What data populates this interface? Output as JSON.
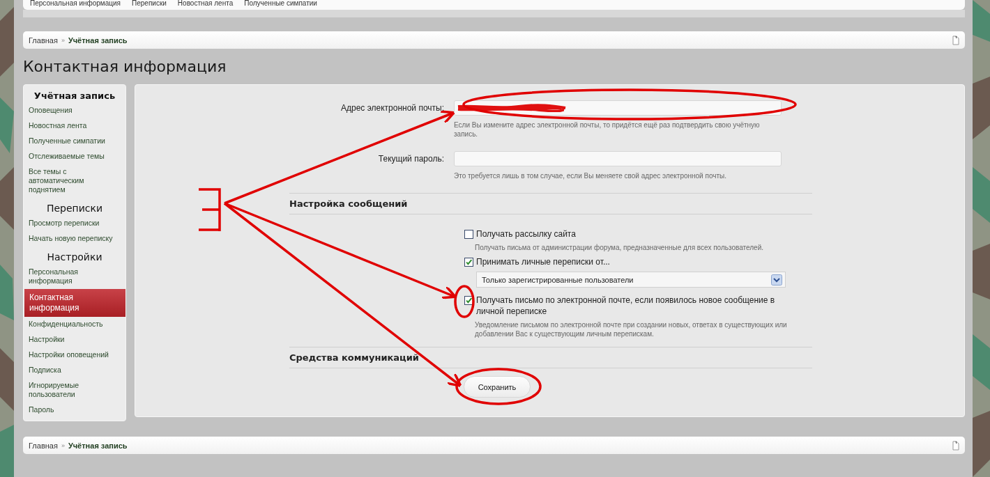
{
  "top_nav": {
    "items": [
      {
        "label": "Персональная информация"
      },
      {
        "label": "Переписки"
      },
      {
        "label": "Новостная лента"
      },
      {
        "label": "Полученные симпатии"
      }
    ]
  },
  "breadcrumb_top": [
    {
      "label": "Главная",
      "current": false
    },
    {
      "separator": "»",
      "label": "Учётная запись",
      "current": true
    }
  ],
  "page_title": "Контактная информация",
  "sidebar": {
    "sections": [
      {
        "heading": "Учётная запись",
        "items": [
          {
            "label": "Оповещения",
            "selected": false
          },
          {
            "label": "Новостная лента",
            "selected": false
          },
          {
            "label": "Полученные симпатии",
            "selected": false
          },
          {
            "label": "Отслеживаемые темы",
            "selected": false
          },
          {
            "label": "Все темы с автоматическим поднятием",
            "selected": false
          }
        ]
      },
      {
        "heading": "Переписки",
        "items": [
          {
            "label": "Просмотр переписки",
            "selected": false
          },
          {
            "label": "Начать новую переписку",
            "selected": false
          }
        ]
      },
      {
        "heading": "Настройки",
        "items": [
          {
            "label": "Персональная информация",
            "selected": false
          },
          {
            "label": "Контактная информация",
            "selected": true
          },
          {
            "label": "Конфиденциальность",
            "selected": false
          },
          {
            "label": "Настройки",
            "selected": false
          },
          {
            "label": "Настройки оповещений",
            "selected": false
          },
          {
            "label": "Подписка",
            "selected": false
          },
          {
            "label": "Игнорируемые пользователи",
            "selected": false
          },
          {
            "label": "Пароль",
            "selected": false
          }
        ]
      }
    ]
  },
  "form": {
    "fields": [
      {
        "label": "Адрес электронной почты:",
        "kind": "email",
        "hint": "Если Вы измените адрес электронной почты, то придётся ещё раз подтвердить свою учётную запись."
      },
      {
        "label": "Текущий пароль:",
        "kind": "password",
        "hint": "Это требуется лишь в том случае, если Вы меняете свой адрес электронной почты."
      }
    ],
    "sections": [
      {
        "heading": "Настройка сообщений",
        "options": [
          {
            "kind": "checkbox",
            "label": "Получать рассылку сайта",
            "checked": false,
            "hint": "Получать письма от администрации форума, предназначенные для всех пользователей."
          },
          {
            "kind": "checkbox",
            "label": "Принимать личные переписки от...",
            "checked": true
          },
          {
            "kind": "select",
            "value": "Только зарегистрированные пользователи"
          },
          {
            "kind": "checkbox",
            "label": "Получать письмо по электронной почте, если появилось новое сообщение в личной переписке",
            "checked": true,
            "hint": "Уведомление письмом по электронной почте при создании новых, ответах в существующих или добавлении Вас к существующим личным перепискам."
          }
        ]
      },
      {
        "heading": "Средства коммуникаций"
      }
    ],
    "button": "Сохранить"
  },
  "breadcrumb_bottom": [
    {
      "label": "Главная",
      "current": false
    },
    {
      "separator": "»",
      "label": "Учётная запись",
      "current": true
    }
  ]
}
